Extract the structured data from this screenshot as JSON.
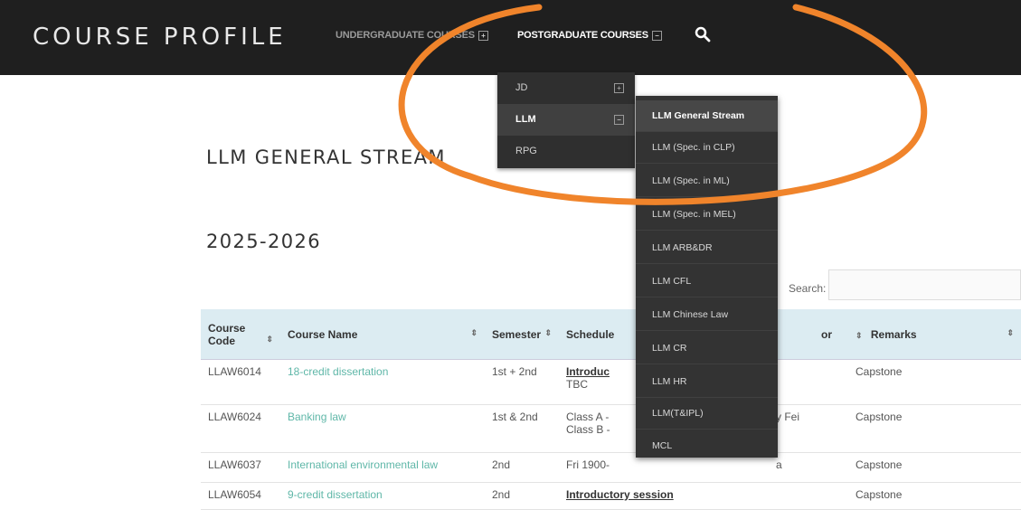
{
  "nav": {
    "brand": "COURSE PROFILE",
    "undergrad": "UNDERGRADUATE COURSES",
    "postgrad": "POSTGRADUATE COURSES"
  },
  "menu_level1": [
    {
      "label": "JD",
      "toggle": "+"
    },
    {
      "label": "LLM",
      "toggle": "−"
    },
    {
      "label": "RPG",
      "toggle": ""
    }
  ],
  "menu_level2": [
    "LLM General Stream",
    "LLM (Spec. in CLP)",
    "LLM (Spec. in ML)",
    "LLM (Spec. in MEL)",
    "LLM ARB&DR",
    "LLM CFL",
    "LLM Chinese Law",
    "LLM CR",
    "LLM HR",
    "LLM(T&IPL)",
    "MCL"
  ],
  "page": {
    "heading": "LLM GENERAL STREAM",
    "year": "2025-2026",
    "search_label": "Search:"
  },
  "table": {
    "headers": [
      "Course Code",
      "Course Name",
      "Semester",
      "Schedule",
      "Instructor",
      "Remarks"
    ],
    "header_visible": {
      "code": "Course Code",
      "name": "Course Name",
      "semester": "Semester",
      "schedule": "Schedule",
      "instructor": "or",
      "remarks": "Remarks"
    },
    "rows": [
      {
        "code": "LLAW6014",
        "name": "18-credit dissertation",
        "semester": "1st + 2nd",
        "schedule_1": "Introduc",
        "schedule_2": "TBC",
        "instructor": "",
        "remarks": "Capstone"
      },
      {
        "code": "LLAW6024",
        "name": "Banking law",
        "semester": "1st & 2nd",
        "schedule_1": "Class A -",
        "schedule_2": "Class B -",
        "instructor": "y Fei",
        "remarks": "Capstone"
      },
      {
        "code": "LLAW6037",
        "name": "International environmental law",
        "semester": "2nd",
        "schedule_1": "Fri 1900-",
        "schedule_2": "",
        "instructor": "a",
        "remarks": "Capstone"
      },
      {
        "code": "LLAW6054",
        "name": "9-credit dissertation",
        "semester": "2nd",
        "schedule_1": "Introductory session",
        "schedule_2": "",
        "instructor": "",
        "remarks": "Capstone"
      }
    ]
  },
  "colors": {
    "navbar": "#1f1f1f",
    "table_header": "#dcecf2",
    "link": "#5fb7a8",
    "highlight": "#f0842b"
  }
}
